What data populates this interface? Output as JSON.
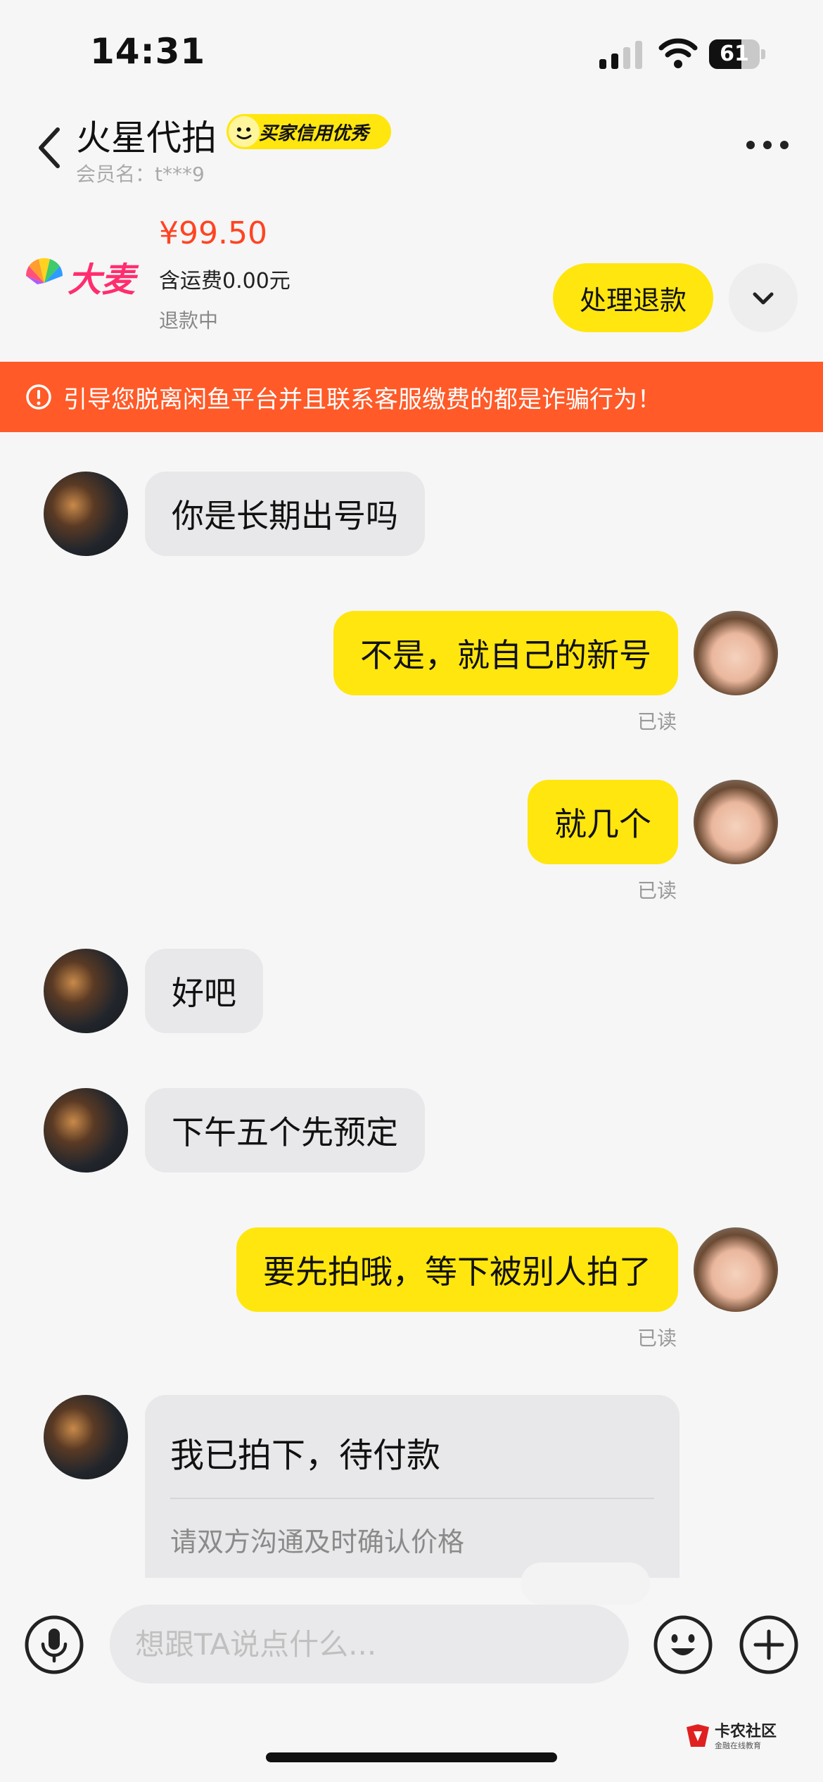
{
  "status_bar": {
    "time": "14:31",
    "battery": "61"
  },
  "header": {
    "name": "火星代拍",
    "credit_badge": "买家信用优秀",
    "member": "会员名：t***9"
  },
  "order": {
    "logo_text": "大麦",
    "price": "¥99.50",
    "shipping": "含运费0.00元",
    "status": "退款中",
    "refund_button": "处理退款"
  },
  "warning": "引导您脱离闲鱼平台并且联系客服缴费的都是诈骗行为！",
  "messages": [
    {
      "side": "in",
      "text": "你是长期出号吗"
    },
    {
      "side": "out",
      "text": "不是，就自己的新号",
      "status": "已读"
    },
    {
      "side": "out",
      "text": "就几个",
      "status": "已读"
    },
    {
      "side": "in",
      "text": "好吧"
    },
    {
      "side": "in",
      "text": "下午五个先预定"
    },
    {
      "side": "out",
      "text": "要先拍哦，等下被别人拍了",
      "status": "已读"
    }
  ],
  "order_card": {
    "title": "我已拍下，待付款",
    "subtitle": "请双方沟通及时确认价格"
  },
  "input": {
    "placeholder": "想跟TA说点什么..."
  },
  "watermark": {
    "title": "卡农社区",
    "subtitle": "金融在线教育"
  },
  "colors": {
    "accent": "#ffe60f",
    "warning": "#ff5a28",
    "price": "#ff4422"
  }
}
